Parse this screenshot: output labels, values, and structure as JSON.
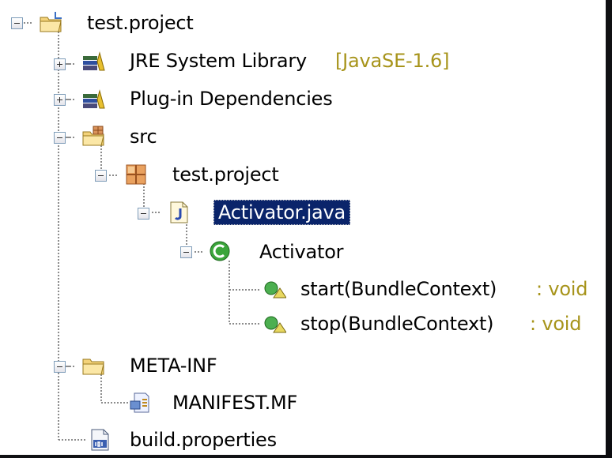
{
  "tree": {
    "nodes": [
      {
        "label": "test.project",
        "icon": "project-folder-icon"
      },
      {
        "label": "JRE System Library",
        "decoration": "[JavaSE-1.6]",
        "icon": "library-icon"
      },
      {
        "label": "Plug-in Dependencies",
        "icon": "library-icon"
      },
      {
        "label": "src",
        "icon": "source-folder-icon"
      },
      {
        "label": "test.project",
        "icon": "package-icon"
      },
      {
        "label": "Activator.java",
        "icon": "java-file-icon",
        "selected": true
      },
      {
        "label": "Activator",
        "icon": "class-icon"
      },
      {
        "label": "start(BundleContext)",
        "decoration": ": void",
        "icon": "method-icon"
      },
      {
        "label": "stop(BundleContext)",
        "decoration": ": void",
        "icon": "method-icon"
      },
      {
        "label": "META-INF",
        "icon": "folder-icon"
      },
      {
        "label": "MANIFEST.MF",
        "icon": "manifest-icon"
      },
      {
        "label": "build.properties",
        "icon": "properties-file-icon"
      }
    ]
  },
  "colors": {
    "selection": "#0a246a",
    "decoration_text": "#a7941b",
    "guide_line": "#8c8c8c"
  }
}
